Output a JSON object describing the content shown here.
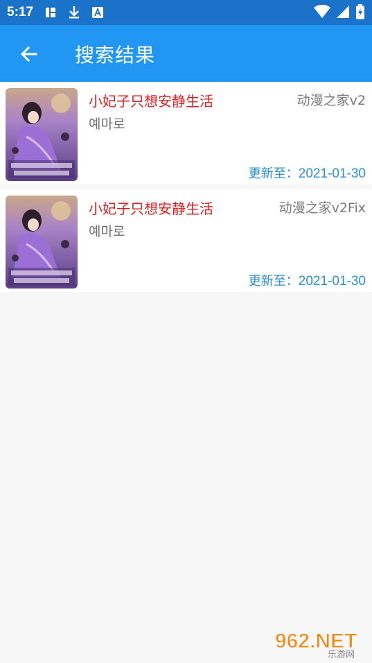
{
  "status_bar": {
    "time": "5:17",
    "icons": [
      "sim-card-icon",
      "download-icon",
      "font-a-icon",
      "wifi-icon",
      "cell-signal-icon",
      "battery-icon"
    ]
  },
  "app_bar": {
    "title": "搜索结果",
    "back_icon": "arrow-left-icon",
    "color": "#2196f3"
  },
  "results": [
    {
      "title": "小妃子只想安静生活",
      "author": "예마로",
      "source": "动漫之家v2",
      "updated_label": "更新至：",
      "updated_date": "2021-01-30"
    },
    {
      "title": "小妃子只想安静生活",
      "author": "예마로",
      "source": "动漫之家v2Fix",
      "updated_label": "更新至：",
      "updated_date": "2021-01-30"
    }
  ],
  "watermark": {
    "brand": "962.NET",
    "sub": "乐游网"
  }
}
